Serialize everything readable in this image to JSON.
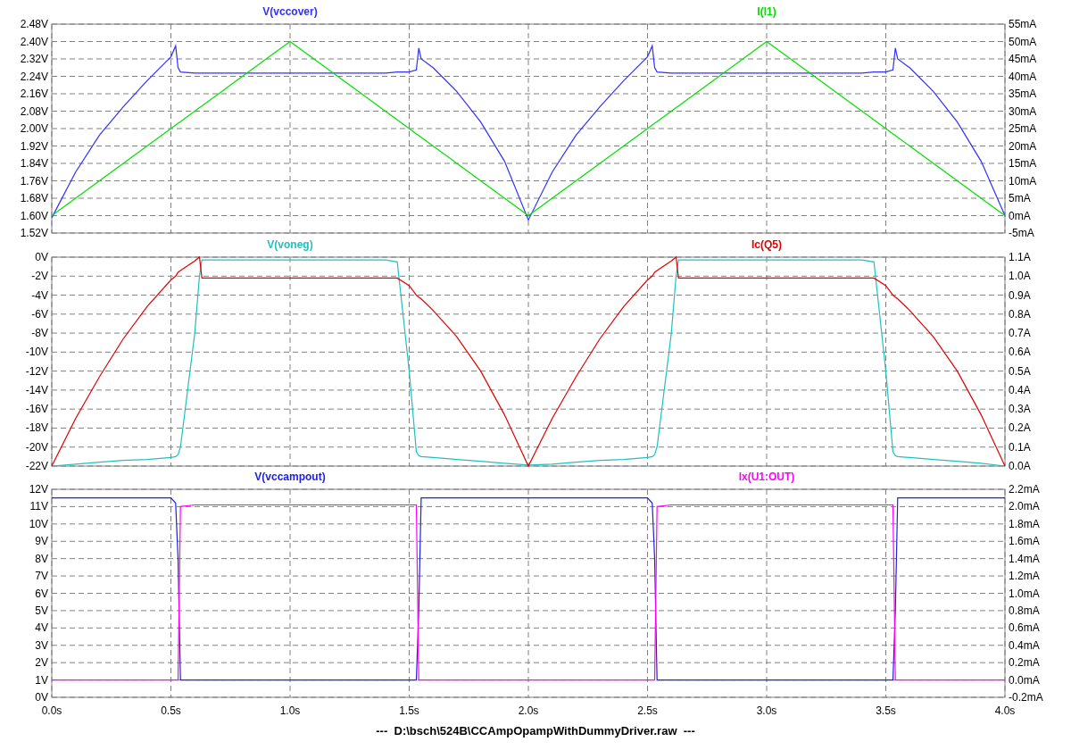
{
  "panes": [
    {
      "chart_data": {
        "type": "line",
        "grid": true,
        "xlim": [
          0,
          4
        ],
        "ylim": [
          1.52,
          2.48
        ],
        "y2lim": [
          -5,
          55
        ],
        "yticks": [
          {
            "value": 1.52,
            "label": "1.52V"
          },
          {
            "value": 1.6,
            "label": "1.60V"
          },
          {
            "value": 1.68,
            "label": "1.68V"
          },
          {
            "value": 1.76,
            "label": "1.76V"
          },
          {
            "value": 1.84,
            "label": "1.84V"
          },
          {
            "value": 1.92,
            "label": "1.92V"
          },
          {
            "value": 2.0,
            "label": "2.00V"
          },
          {
            "value": 2.08,
            "label": "2.08V"
          },
          {
            "value": 2.16,
            "label": "2.16V"
          },
          {
            "value": 2.24,
            "label": "2.24V"
          },
          {
            "value": 2.32,
            "label": "2.32V"
          },
          {
            "value": 2.4,
            "label": "2.40V"
          },
          {
            "value": 2.48,
            "label": "2.48V"
          }
        ],
        "y2ticks": [
          {
            "value": -5,
            "label": "-5mA"
          },
          {
            "value": 0,
            "label": "0mA"
          },
          {
            "value": 5,
            "label": "5mA"
          },
          {
            "value": 10,
            "label": "10mA"
          },
          {
            "value": 15,
            "label": "15mA"
          },
          {
            "value": 20,
            "label": "20mA"
          },
          {
            "value": 25,
            "label": "25mA"
          },
          {
            "value": 30,
            "label": "30mA"
          },
          {
            "value": 35,
            "label": "35mA"
          },
          {
            "value": 40,
            "label": "40mA"
          },
          {
            "value": 45,
            "label": "45mA"
          },
          {
            "value": 50,
            "label": "50mA"
          },
          {
            "value": 55,
            "label": "55mA"
          }
        ],
        "x": [
          0,
          0.1,
          0.2,
          0.3,
          0.4,
          0.5,
          0.52,
          0.53,
          0.54,
          0.6,
          0.62,
          0.63,
          0.64,
          0.8,
          1.0,
          1.2,
          1.4,
          1.45,
          1.5,
          1.53,
          1.54,
          1.55,
          1.6,
          1.7,
          1.8,
          1.9,
          2.0,
          2.1,
          2.2,
          2.3,
          2.4,
          2.5,
          2.52,
          2.53,
          2.54,
          2.6,
          2.62,
          2.63,
          2.64,
          2.8,
          3.0,
          3.2,
          3.4,
          3.45,
          3.5,
          3.53,
          3.54,
          3.55,
          3.6,
          3.7,
          3.8,
          3.9,
          4.0
        ],
        "series": [
          {
            "name": "V(vccover)",
            "color": "#3030ff",
            "values": [
              1.59,
              1.8,
              1.97,
              2.1,
              2.22,
              2.33,
              2.38,
              2.28,
              2.26,
              2.255,
              2.255,
              2.255,
              2.255,
              2.255,
              2.255,
              2.255,
              2.255,
              2.26,
              2.26,
              2.27,
              2.37,
              2.32,
              2.28,
              2.17,
              2.03,
              1.85,
              1.58,
              1.8,
              1.97,
              2.1,
              2.22,
              2.33,
              2.38,
              2.28,
              2.26,
              2.255,
              2.255,
              2.255,
              2.255,
              2.255,
              2.255,
              2.255,
              2.255,
              2.26,
              2.26,
              2.27,
              2.37,
              2.32,
              2.28,
              2.17,
              2.03,
              1.85,
              1.6
            ]
          },
          {
            "name": "I(I1)",
            "color": "#00e000",
            "axis": "y2",
            "values": [
              0,
              5,
              10,
              15,
              20,
              25,
              26,
              26.5,
              27,
              30,
              31,
              31.5,
              32,
              40,
              50,
              40,
              30,
              27.5,
              25,
              23.5,
              23,
              22.5,
              20,
              15,
              10,
              5,
              0,
              5,
              10,
              15,
              20,
              25,
              26,
              26.5,
              27,
              30,
              31,
              31.5,
              32,
              40,
              50,
              40,
              30,
              27.5,
              25,
              23.5,
              23,
              22.5,
              20,
              15,
              10,
              5,
              0
            ]
          }
        ]
      }
    },
    {
      "chart_data": {
        "type": "line",
        "grid": true,
        "xlim": [
          0,
          4
        ],
        "ylim": [
          -22,
          0
        ],
        "y2lim": [
          0,
          1.1
        ],
        "yticks": [
          {
            "value": 0,
            "label": "0V"
          },
          {
            "value": -2,
            "label": "-2V"
          },
          {
            "value": -4,
            "label": "-4V"
          },
          {
            "value": -6,
            "label": "-6V"
          },
          {
            "value": -8,
            "label": "-8V"
          },
          {
            "value": -10,
            "label": "-10V"
          },
          {
            "value": -12,
            "label": "-12V"
          },
          {
            "value": -14,
            "label": "-14V"
          },
          {
            "value": -16,
            "label": "-16V"
          },
          {
            "value": -18,
            "label": "-18V"
          },
          {
            "value": -20,
            "label": "-20V"
          },
          {
            "value": -22,
            "label": "-22V"
          }
        ],
        "y2ticks": [
          {
            "value": 1.1,
            "label": "1.1A"
          },
          {
            "value": 1.0,
            "label": "1.0A"
          },
          {
            "value": 0.9,
            "label": "0.9A"
          },
          {
            "value": 0.8,
            "label": "0.8A"
          },
          {
            "value": 0.7,
            "label": "0.7A"
          },
          {
            "value": 0.6,
            "label": "0.6A"
          },
          {
            "value": 0.5,
            "label": "0.5A"
          },
          {
            "value": 0.4,
            "label": "0.4A"
          },
          {
            "value": 0.3,
            "label": "0.3A"
          },
          {
            "value": 0.2,
            "label": "0.2A"
          },
          {
            "value": 0.1,
            "label": "0.1A"
          },
          {
            "value": 0,
            "label": "0.0A"
          }
        ],
        "x": [
          0,
          0.1,
          0.2,
          0.3,
          0.4,
          0.5,
          0.52,
          0.53,
          0.54,
          0.6,
          0.62,
          0.63,
          0.64,
          0.8,
          1.0,
          1.2,
          1.4,
          1.45,
          1.5,
          1.53,
          1.54,
          1.55,
          1.6,
          1.7,
          1.8,
          1.9,
          2.0,
          2.1,
          2.2,
          2.3,
          2.4,
          2.5,
          2.52,
          2.53,
          2.54,
          2.6,
          2.62,
          2.63,
          2.64,
          2.8,
          3.0,
          3.2,
          3.4,
          3.45,
          3.5,
          3.53,
          3.54,
          3.55,
          3.6,
          3.7,
          3.8,
          3.9,
          4.0
        ],
        "series": [
          {
            "name": "V(voneg)",
            "color": "#20c0c0",
            "values": [
              -22,
              -21.8,
              -21.6,
              -21.4,
              -21.3,
              -21.1,
              -21.0,
              -20.8,
              -20.0,
              -8,
              -2,
              -0.3,
              -0.3,
              -0.3,
              -0.3,
              -0.3,
              -0.3,
              -0.5,
              -12,
              -20.5,
              -20.9,
              -21.0,
              -21.1,
              -21.3,
              -21.5,
              -21.7,
              -21.9,
              -21.8,
              -21.6,
              -21.4,
              -21.3,
              -21.1,
              -21.0,
              -20.8,
              -20.0,
              -8,
              -2,
              -0.3,
              -0.3,
              -0.3,
              -0.3,
              -0.3,
              -0.3,
              -0.5,
              -12,
              -20.5,
              -20.9,
              -21.0,
              -21.1,
              -21.3,
              -21.5,
              -21.7,
              -22
            ]
          },
          {
            "name": "Ic(Q5)",
            "color": "#e00000",
            "axis": "y2",
            "values": [
              0,
              0.25,
              0.47,
              0.67,
              0.84,
              0.98,
              1.0,
              1.02,
              1.03,
              1.08,
              1.1,
              0.99,
              0.99,
              0.99,
              0.99,
              0.99,
              0.99,
              0.99,
              0.95,
              0.9,
              0.89,
              0.88,
              0.82,
              0.68,
              0.5,
              0.27,
              0,
              0.25,
              0.47,
              0.67,
              0.84,
              0.98,
              1.0,
              1.02,
              1.03,
              1.08,
              1.1,
              0.99,
              0.99,
              0.99,
              0.99,
              0.99,
              0.99,
              0.99,
              0.95,
              0.9,
              0.89,
              0.88,
              0.82,
              0.68,
              0.5,
              0.27,
              0
            ]
          }
        ]
      }
    },
    {
      "chart_data": {
        "type": "line",
        "grid": true,
        "xlim": [
          0,
          4
        ],
        "ylim": [
          0,
          12
        ],
        "y2lim": [
          -0.2,
          2.2
        ],
        "xticks": [
          {
            "value": 0,
            "label": "0.0s"
          },
          {
            "value": 0.5,
            "label": "0.5s"
          },
          {
            "value": 1,
            "label": "1.0s"
          },
          {
            "value": 1.5,
            "label": "1.5s"
          },
          {
            "value": 2,
            "label": "2.0s"
          },
          {
            "value": 2.5,
            "label": "2.5s"
          },
          {
            "value": 3,
            "label": "3.0s"
          },
          {
            "value": 3.5,
            "label": "3.5s"
          },
          {
            "value": 4,
            "label": "4.0s"
          }
        ],
        "yticks": [
          {
            "value": 0,
            "label": "0V"
          },
          {
            "value": 1,
            "label": "1V"
          },
          {
            "value": 2,
            "label": "2V"
          },
          {
            "value": 3,
            "label": "3V"
          },
          {
            "value": 4,
            "label": "4V"
          },
          {
            "value": 5,
            "label": "5V"
          },
          {
            "value": 6,
            "label": "6V"
          },
          {
            "value": 7,
            "label": "7V"
          },
          {
            "value": 8,
            "label": "8V"
          },
          {
            "value": 9,
            "label": "9V"
          },
          {
            "value": 10,
            "label": "10V"
          },
          {
            "value": 11,
            "label": "11V"
          },
          {
            "value": 12,
            "label": "12V"
          }
        ],
        "y2ticks": [
          {
            "value": -0.2,
            "label": "-0.2mA"
          },
          {
            "value": 0,
            "label": "0.0mA"
          },
          {
            "value": 0.2,
            "label": "0.2mA"
          },
          {
            "value": 0.4,
            "label": "0.4mA"
          },
          {
            "value": 0.6,
            "label": "0.6mA"
          },
          {
            "value": 0.8,
            "label": "0.8mA"
          },
          {
            "value": 1.0,
            "label": "1.0mA"
          },
          {
            "value": 1.2,
            "label": "1.2mA"
          },
          {
            "value": 1.4,
            "label": "1.4mA"
          },
          {
            "value": 1.6,
            "label": "1.6mA"
          },
          {
            "value": 1.8,
            "label": "1.8mA"
          },
          {
            "value": 2.0,
            "label": "2.0mA"
          },
          {
            "value": 2.2,
            "label": "2.2mA"
          }
        ],
        "x": [
          0,
          0.1,
          0.2,
          0.3,
          0.4,
          0.5,
          0.52,
          0.53,
          0.54,
          0.6,
          0.62,
          0.63,
          0.64,
          0.8,
          1.0,
          1.2,
          1.4,
          1.45,
          1.5,
          1.53,
          1.54,
          1.55,
          1.6,
          1.7,
          1.8,
          1.9,
          2.0,
          2.1,
          2.2,
          2.3,
          2.4,
          2.5,
          2.52,
          2.53,
          2.54,
          2.6,
          2.62,
          2.63,
          2.64,
          2.8,
          3.0,
          3.2,
          3.4,
          3.45,
          3.5,
          3.53,
          3.54,
          3.55,
          3.6,
          3.7,
          3.8,
          3.9,
          4.0
        ],
        "series": [
          {
            "name": "V(vccampout)",
            "color": "#2020e0",
            "values": [
              11.5,
              11.5,
              11.5,
              11.5,
              11.5,
              11.5,
              11.2,
              8,
              1,
              1,
              1,
              1,
              1,
              1,
              1,
              1,
              1,
              1,
              1,
              1,
              5,
              11.5,
              11.5,
              11.5,
              11.5,
              11.5,
              11.5,
              11.5,
              11.5,
              11.5,
              11.5,
              11.5,
              11.2,
              8,
              1,
              1,
              1,
              1,
              1,
              1,
              1,
              1,
              1,
              1,
              1,
              1,
              5,
              11.5,
              11.5,
              11.5,
              11.5,
              11.5,
              11.5
            ]
          },
          {
            "name": "Ix(U1:OUT)",
            "color": "#ff00ff",
            "axis": "y2",
            "values": [
              0,
              0,
              0,
              0,
              0,
              0,
              0,
              0,
              2.0,
              2.02,
              2.02,
              2.02,
              2.02,
              2.02,
              2.02,
              2.02,
              2.02,
              2.02,
              2.02,
              2.02,
              0,
              0,
              0,
              0,
              0,
              0,
              0,
              0,
              0,
              0,
              0,
              0,
              0,
              0,
              2.0,
              2.02,
              2.02,
              2.02,
              2.02,
              2.02,
              2.02,
              2.02,
              2.02,
              2.02,
              2.02,
              2.02,
              0,
              0,
              0,
              0,
              0,
              0,
              0
            ]
          }
        ]
      }
    }
  ],
  "footer": "---  D:\\bsch\\524B\\CCAmpOpampWithDummyDriver.raw  ---"
}
